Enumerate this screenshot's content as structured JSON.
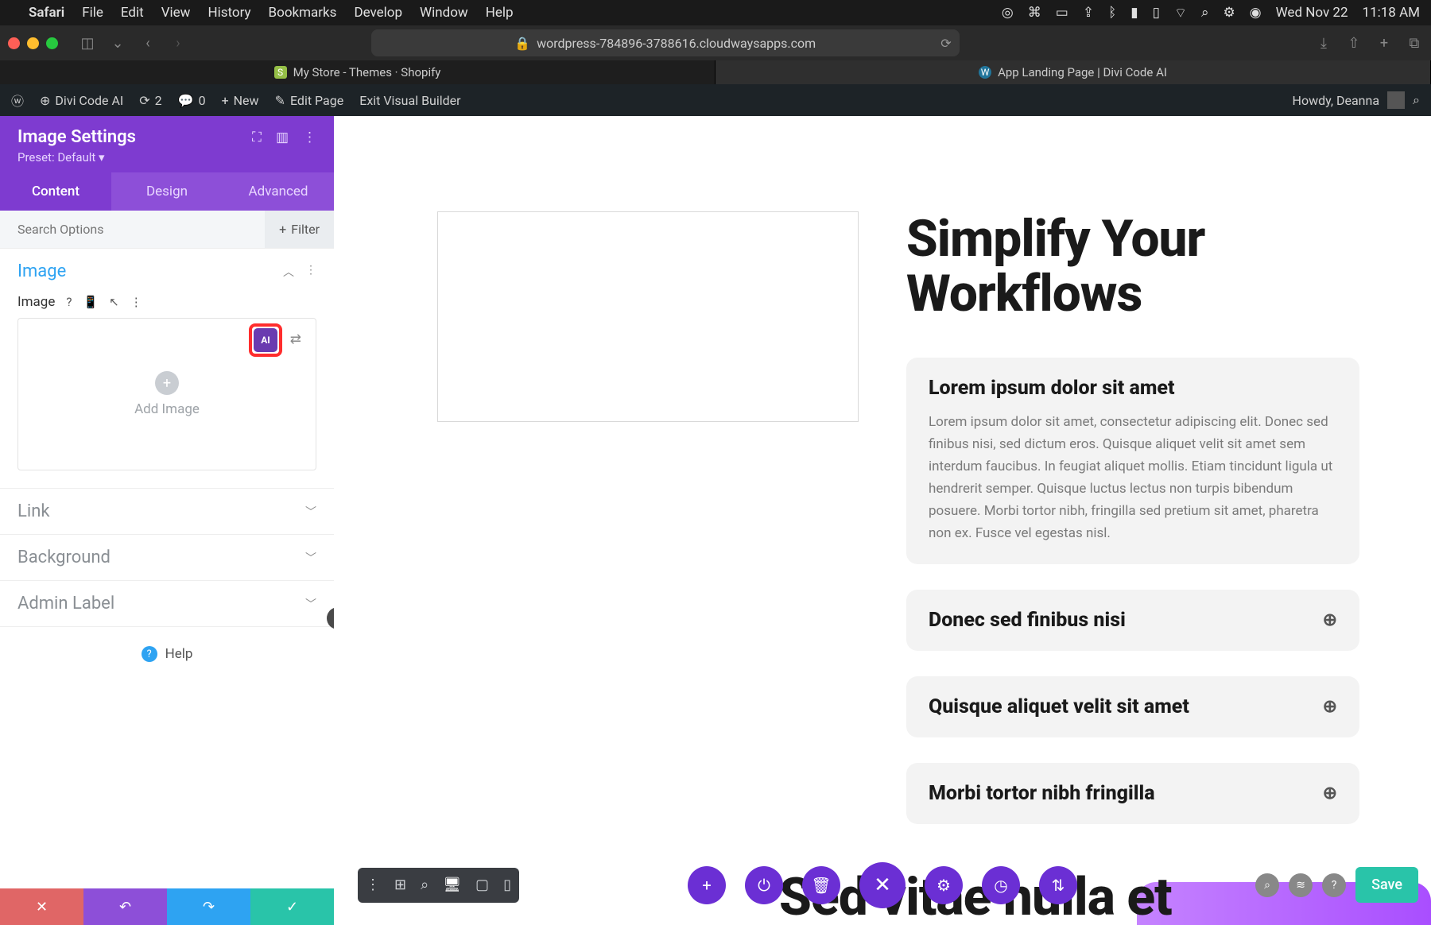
{
  "menubar": {
    "app": "Safari",
    "items": [
      "File",
      "Edit",
      "View",
      "History",
      "Bookmarks",
      "Develop",
      "Window",
      "Help"
    ],
    "date": "Wed Nov 22",
    "time": "11:18 AM"
  },
  "safari": {
    "url": "wordpress-784896-3788616.cloudwaysapps.com",
    "tabs": [
      {
        "title": "My Store - Themes · Shopify",
        "favicon": "S"
      },
      {
        "title": "App Landing Page | Divi Code AI",
        "favicon": "W"
      }
    ]
  },
  "wpbar": {
    "site": "Divi Code AI",
    "updates": "2",
    "comments": "0",
    "new": "New",
    "editPage": "Edit Page",
    "exitVB": "Exit Visual Builder",
    "howdy": "Howdy, Deanna"
  },
  "sidebar": {
    "title": "Image Settings",
    "preset": "Preset: Default",
    "tabs": {
      "content": "Content",
      "design": "Design",
      "advanced": "Advanced"
    },
    "search_placeholder": "Search Options",
    "filter": "Filter",
    "sections": {
      "image": {
        "title": "Image",
        "label": "Image",
        "ai_badge": "AI",
        "add": "Add Image"
      },
      "link": "Link",
      "background": "Background",
      "adminLabel": "Admin Label"
    },
    "help": "Help"
  },
  "canvas": {
    "heading": "Simplify Your Workflows",
    "accordion": [
      {
        "title": "Lorem ipsum dolor sit amet",
        "body": "Lorem ipsum dolor sit amet, consectetur adipiscing elit. Donec sed finibus nisi, sed dictum eros. Quisque aliquet velit sit amet sem interdum faucibus. In feugiat aliquet mollis. Etiam tincidunt ligula ut hendrerit semper. Quisque luctus lectus non turpis bibendum posuere. Morbi tortor nibh, fringilla sed pretium sit amet, pharetra non ex. Fusce vel egestas nisl.",
        "open": true
      },
      {
        "title": "Donec sed finibus nisi",
        "open": false
      },
      {
        "title": "Quisque aliquet velit sit amet",
        "open": false
      },
      {
        "title": "Morbi tortor nibh fringilla",
        "open": false
      }
    ],
    "nextHeading": "Sed vitae nulla et"
  },
  "divibar": {
    "save": "Save"
  }
}
